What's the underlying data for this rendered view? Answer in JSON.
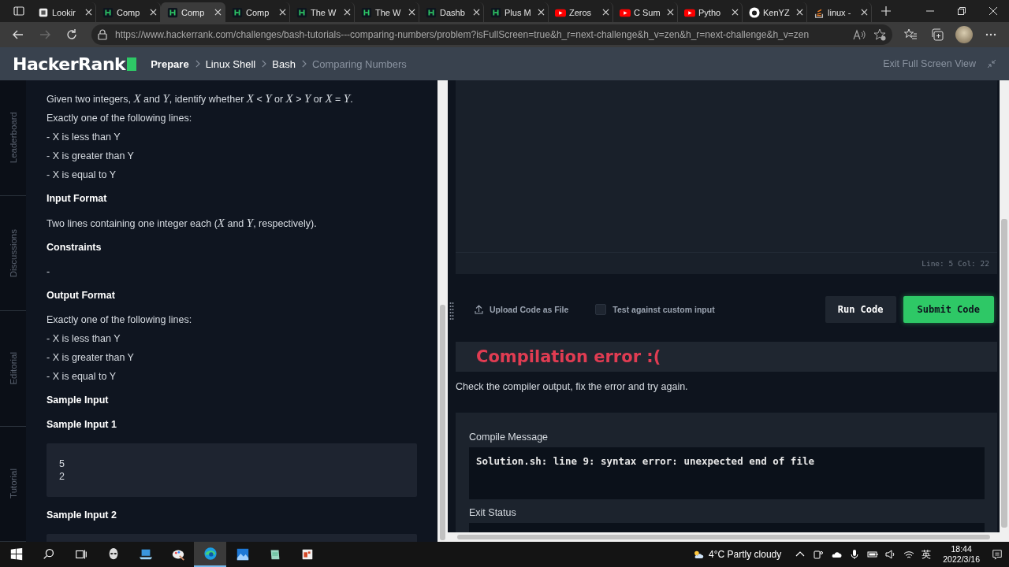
{
  "browser": {
    "tabs": [
      {
        "label": "Lookir",
        "kind": "notion",
        "selected": false
      },
      {
        "label": "Comp",
        "kind": "hr",
        "selected": false
      },
      {
        "label": "Comp",
        "kind": "hr",
        "selected": true
      },
      {
        "label": "Comp",
        "kind": "hr",
        "selected": false
      },
      {
        "label": "The W",
        "kind": "hr",
        "selected": false
      },
      {
        "label": "The W",
        "kind": "hr",
        "selected": false
      },
      {
        "label": "Dashb",
        "kind": "hr",
        "selected": false
      },
      {
        "label": "Plus M",
        "kind": "hr",
        "selected": false
      },
      {
        "label": "Zeros",
        "kind": "yt",
        "selected": false
      },
      {
        "label": "C Sum",
        "kind": "yt",
        "selected": false
      },
      {
        "label": "Pytho",
        "kind": "yt",
        "selected": false
      },
      {
        "label": "KenYZ",
        "kind": "gh",
        "selected": false
      },
      {
        "label": "linux -",
        "kind": "so",
        "selected": false
      }
    ],
    "url": "https://www.hackerrank.com/challenges/bash-tutorials---comparing-numbers/problem?isFullScreen=true&h_r=next-challenge&h_v=zen&h_r=next-challenge&h_v=zen"
  },
  "header": {
    "logo": "HackerRank",
    "breadcrumb": [
      {
        "label": "Prepare",
        "current": false
      },
      {
        "label": "Linux Shell",
        "current": false
      },
      {
        "label": "Bash",
        "current": false
      },
      {
        "label": "Comparing Numbers",
        "current": true
      }
    ],
    "exit_full_screen": "Exit Full Screen View"
  },
  "side_tabs": [
    "Leaderboard",
    "Discussions",
    "Editorial",
    "Tutorial"
  ],
  "problem": {
    "blocks": [
      {
        "kind": "paragraph",
        "text": "Given two integers, *X* and *Y*, identify whether *X* < *Y* or *X* > *Y* or *X* = *Y*."
      },
      {
        "kind": "paragraph",
        "text": "Exactly one of the following lines:"
      },
      {
        "kind": "paragraph",
        "text": "- X is less than Y"
      },
      {
        "kind": "paragraph",
        "text": "- X is greater than Y"
      },
      {
        "kind": "paragraph",
        "text": "- X is equal to Y"
      },
      {
        "kind": "heading",
        "text": "Input Format"
      },
      {
        "kind": "paragraph",
        "text": "Two lines containing one integer each (*X* and *Y*, respectively)."
      },
      {
        "kind": "heading",
        "text": "Constraints"
      },
      {
        "kind": "paragraph",
        "text": "-"
      },
      {
        "kind": "heading",
        "text": "Output Format"
      },
      {
        "kind": "paragraph",
        "text": "Exactly one of the following lines:"
      },
      {
        "kind": "paragraph",
        "text": "- X is less than Y"
      },
      {
        "kind": "paragraph",
        "text": "- X is greater than Y"
      },
      {
        "kind": "paragraph",
        "text": "- X is equal to Y"
      },
      {
        "kind": "heading",
        "text": "Sample Input"
      },
      {
        "kind": "heading",
        "text": "Sample Input 1"
      },
      {
        "kind": "code",
        "lines": [
          "5",
          "2"
        ]
      },
      {
        "kind": "heading",
        "text": "Sample Input 2"
      },
      {
        "kind": "code"
      }
    ]
  },
  "editor": {
    "status": "Line: 5 Col: 22",
    "upload_label": "Upload Code as File",
    "custom_input": {
      "label": "Test against custom input",
      "checked": false
    },
    "buttons": [
      {
        "label": "Run Code",
        "kind": "secondary"
      },
      {
        "label": "Submit Code",
        "kind": "primary"
      }
    ]
  },
  "result": {
    "title": "Compilation error :(",
    "message": "Check the compiler output, fix the error and try again.",
    "sections": [
      {
        "label": "Compile Message",
        "output": "Solution.sh: line 9: syntax error: unexpected end of file"
      },
      {
        "label": "Exit Status"
      }
    ]
  },
  "taskbar": {
    "apps": [
      {
        "kind": "alien",
        "selected": false
      },
      {
        "kind": "laptop",
        "selected": false
      },
      {
        "kind": "palette",
        "selected": false
      },
      {
        "kind": "edge",
        "selected": true
      },
      {
        "kind": "photos",
        "selected": false
      },
      {
        "kind": "notepad",
        "selected": false
      },
      {
        "kind": "office",
        "selected": false
      }
    ],
    "weather": "4°C Partly cloudy",
    "ime": "英",
    "time": "18:44",
    "date": "2022/3/16"
  }
}
